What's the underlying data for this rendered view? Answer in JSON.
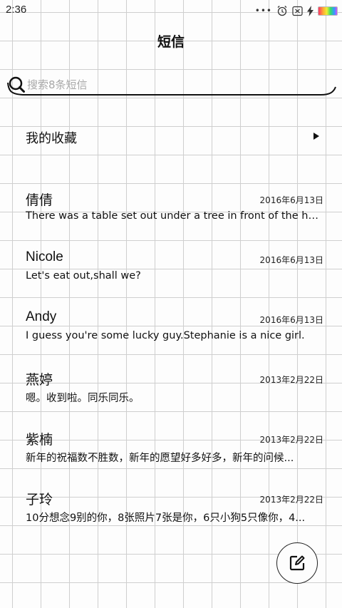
{
  "status_bar": {
    "time": "2:36",
    "dots": "•••",
    "icons": [
      "alarm-icon",
      "close-box-icon",
      "charging-icon",
      "battery-icon"
    ]
  },
  "header": {
    "title": "短信"
  },
  "search": {
    "placeholder": "搜索8条短信",
    "value": ""
  },
  "favorites": {
    "label": "我的收藏"
  },
  "conversations": [
    {
      "name": "倩倩",
      "date": "2016年6月13日",
      "preview": "There was a table set out under a tree in front of the ho..."
    },
    {
      "name": "Nicole",
      "date": "2016年6月13日",
      "preview": "Let's eat out,shall we?"
    },
    {
      "name": "Andy",
      "date": "2016年6月13日",
      "preview": "I guess you're some lucky guy.Stephanie is a nice girl."
    },
    {
      "name": "燕婷",
      "date": "2013年2月22日",
      "preview": "嗯。收到啦。同乐同乐。"
    },
    {
      "name": "紫楠",
      "date": "2013年2月22日",
      "preview": "新年的祝福数不胜数，新年的愿望好多好多，新年的问候..."
    },
    {
      "name": "子玲",
      "date": "2013年2月22日",
      "preview": "10分想念9别的你，8张照片7张是你，6只小狗5只像你，4..."
    }
  ],
  "compose": {
    "icon": "compose-icon"
  },
  "colors": {
    "grid_line": "#cfcfcf",
    "background": "#fdfdfd",
    "text": "#111111"
  }
}
